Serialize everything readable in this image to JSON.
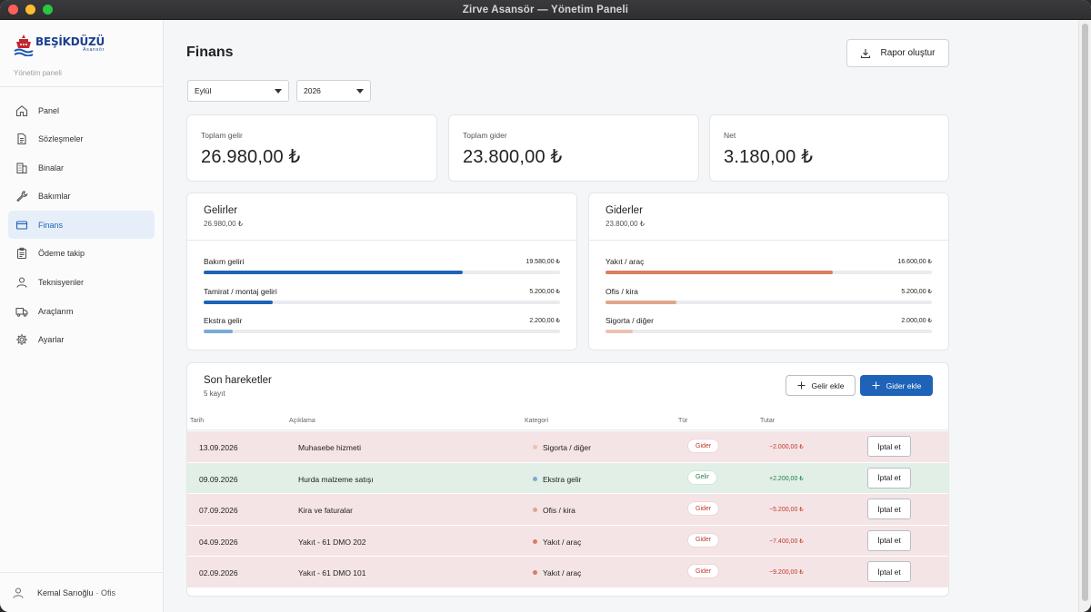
{
  "window": {
    "title": "Zirve Asansör — Yönetim Paneli"
  },
  "brand": {
    "name": "BEŞİKDÜZÜ",
    "tagline": "Asansör",
    "subtitle": "Yönetim paneli"
  },
  "sidebar": {
    "items": [
      {
        "label": "Panel",
        "icon": "home-icon"
      },
      {
        "label": "Sözleşmeler",
        "icon": "document-icon"
      },
      {
        "label": "Binalar",
        "icon": "building-icon"
      },
      {
        "label": "Bakımlar",
        "icon": "wrench-icon"
      },
      {
        "label": "Finans",
        "icon": "credit-card-icon",
        "active": true
      },
      {
        "label": "Ödeme takip",
        "icon": "clipboard-icon"
      },
      {
        "label": "Teknisyenler",
        "icon": "person-icon"
      },
      {
        "label": "Araçlarım",
        "icon": "truck-icon"
      },
      {
        "label": "Ayarlar",
        "icon": "gear-icon"
      }
    ]
  },
  "user": {
    "name": "Kemal Sarıoğlu",
    "role": "· Ofis"
  },
  "page": {
    "title": "Finans",
    "report_button": "Rapor oluştur",
    "month_select": "Eylül",
    "year_select": "2026"
  },
  "stats": [
    {
      "label": "Toplam gelir",
      "value": "26.980,00 ₺"
    },
    {
      "label": "Toplam gider",
      "value": "23.800,00 ₺"
    },
    {
      "label": "Net",
      "value": "3.180,00 ₺"
    }
  ],
  "income": {
    "title": "Gelirler",
    "total": "26.980,00 ₺",
    "items": [
      {
        "label": "Bakım geliri",
        "value": "19.580,00 ₺",
        "fraction": 0.726,
        "color": "#1e63b7"
      },
      {
        "label": "Tamirat / montaj geliri",
        "value": "5.200,00 ₺",
        "fraction": 0.193,
        "color": "#1e63b7"
      },
      {
        "label": "Ekstra gelir",
        "value": "2.200,00 ₺",
        "fraction": 0.082,
        "color": "#7aaad8"
      }
    ]
  },
  "expense": {
    "title": "Giderler",
    "total": "23.800,00 ₺",
    "items": [
      {
        "label": "Yakıt / araç",
        "value": "16.600,00 ₺",
        "fraction": 0.697,
        "color": "#d97e5e"
      },
      {
        "label": "Ofis / kira",
        "value": "5.200,00 ₺",
        "fraction": 0.218,
        "color": "#e0a58b"
      },
      {
        "label": "Sigorta / diğer",
        "value": "2.000,00 ₺",
        "fraction": 0.084,
        "color": "#ecc3b3"
      }
    ]
  },
  "transactions": {
    "title": "Son hareketler",
    "count": "5 kayıt",
    "add_income": "Gelir ekle",
    "add_expense": "Gider ekle",
    "columns": [
      "Tarih",
      "Açıklama",
      "Kategori",
      "Tür",
      "Tutar"
    ],
    "cancel_label": "İptal et",
    "rows": [
      {
        "date": "13.09.2026",
        "desc": "Muhasebe hizmeti",
        "category": "Sigorta / diğer",
        "dot": "#ecc3b3",
        "type": "Gider",
        "kind": "gider",
        "amount": "−2.000,00 ₺"
      },
      {
        "date": "09.09.2026",
        "desc": "Hurda malzeme satışı",
        "category": "Ekstra gelir",
        "dot": "#7aaad8",
        "type": "Gelir",
        "kind": "gelir",
        "amount": "+2.200,00 ₺"
      },
      {
        "date": "07.09.2026",
        "desc": "Kira ve faturalar",
        "category": "Ofis / kira",
        "dot": "#e0a58b",
        "type": "Gider",
        "kind": "gider",
        "amount": "−5.200,00 ₺"
      },
      {
        "date": "04.09.2026",
        "desc": "Yakıt - 61 DMO 202",
        "category": "Yakıt / araç",
        "dot": "#d97e5e",
        "type": "Gider",
        "kind": "gider",
        "amount": "−7.400,00 ₺"
      },
      {
        "date": "02.09.2026",
        "desc": "Yakıt - 61 DMO 101",
        "category": "Yakıt / araç",
        "dot": "#d97e5e",
        "type": "Gider",
        "kind": "gider",
        "amount": "−9.200,00 ₺"
      }
    ]
  }
}
